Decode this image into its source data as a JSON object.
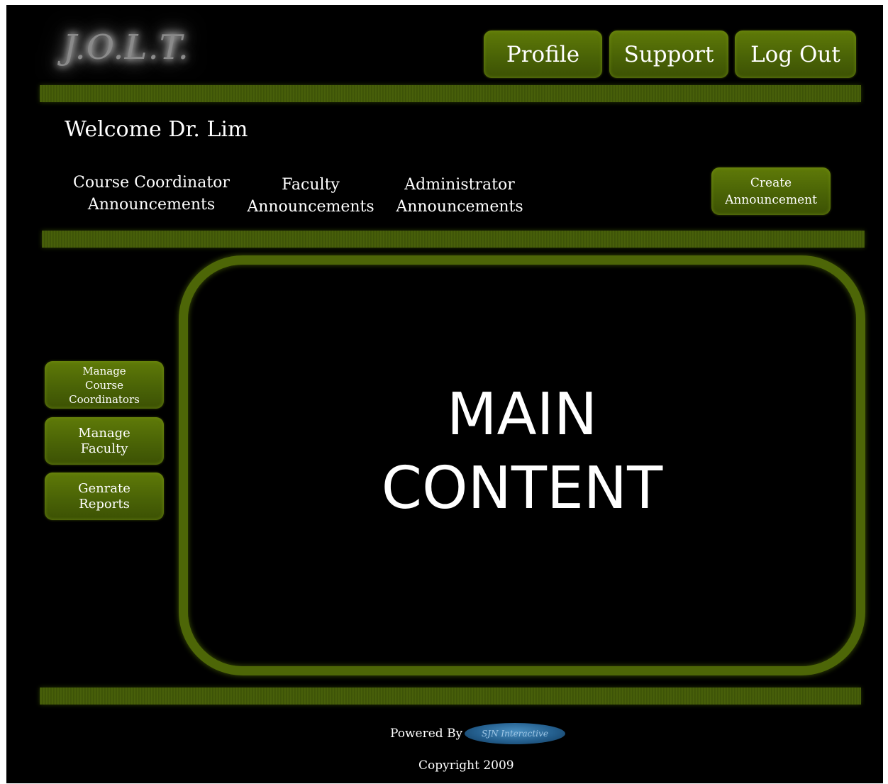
{
  "header": {
    "logo_text": "J.O.L.T.",
    "buttons": {
      "profile": "Profile",
      "support": "Support",
      "logout": "Log Out"
    }
  },
  "welcome": "Welcome Dr. Lim",
  "nav": {
    "course_coordinator": [
      "Course Coordinator",
      "Announcements"
    ],
    "faculty": [
      "Faculty",
      "Announcements"
    ],
    "administrator": [
      "Administrator",
      "Announcements"
    ],
    "create_announcement": [
      "Create",
      "Announcement"
    ]
  },
  "sidebar": {
    "items": [
      [
        "Manage",
        "Course",
        "Coordinators"
      ],
      [
        "Manage",
        "Faculty"
      ],
      [
        "Genrate",
        "Reports"
      ]
    ]
  },
  "main": {
    "line1": "MAIN",
    "line2": "CONTENT"
  },
  "footer": {
    "powered_by": "Powered By",
    "powered_logo_text": "SJN Interactive",
    "copyright": "Copyright 2009"
  },
  "colors": {
    "background": "#000000",
    "accent_green": "#4d6607",
    "text": "#ffffff"
  }
}
